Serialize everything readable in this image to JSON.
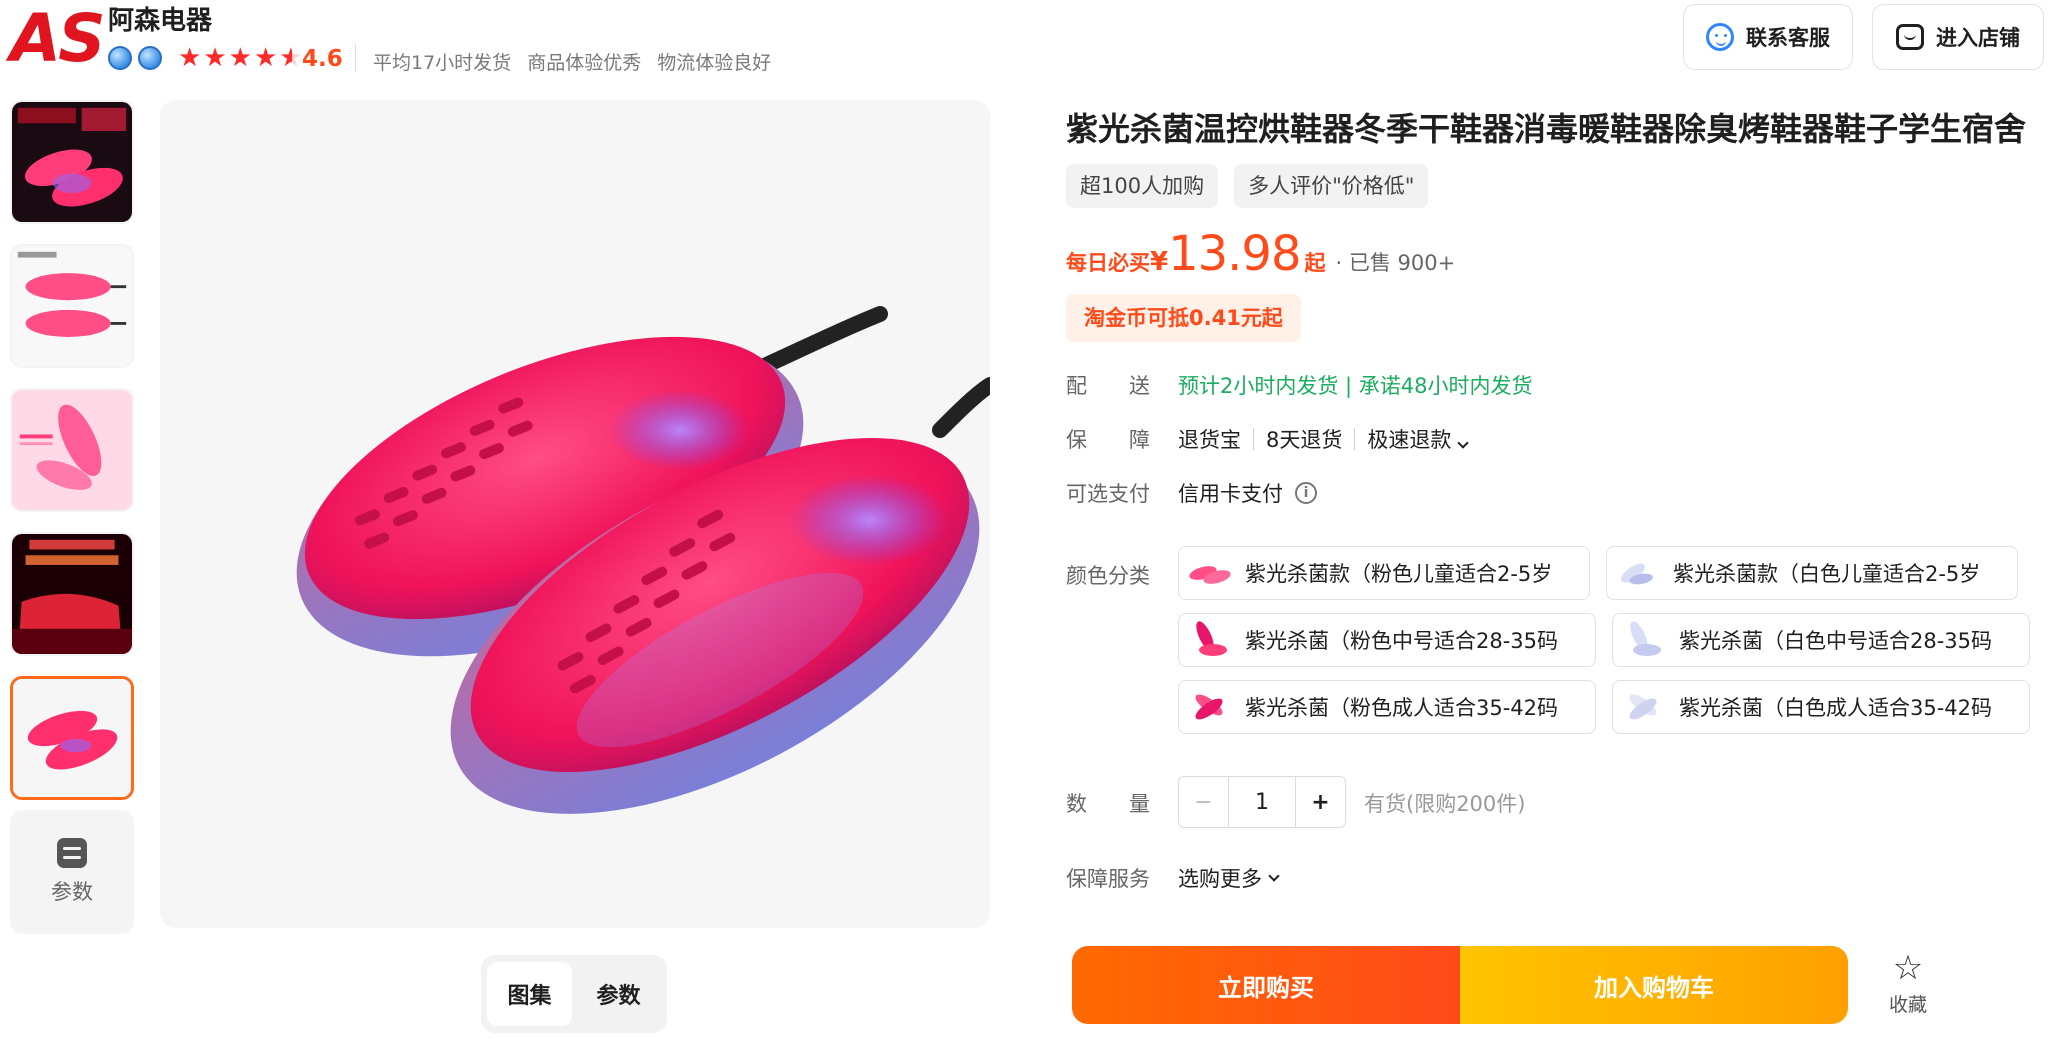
{
  "shop": {
    "logo_text": "AS",
    "name": "阿森电器",
    "rating": "4.6",
    "tags": [
      "平均17小时发货",
      "商品体验优秀",
      "物流体验良好"
    ],
    "contact_button": "联系客服",
    "store_button": "进入店铺"
  },
  "gallery": {
    "params_label": "参数",
    "tabs": [
      {
        "label": "图集",
        "selected": true
      },
      {
        "label": "参数",
        "selected": false
      }
    ]
  },
  "product": {
    "title": "紫光杀菌温控烘鞋器冬季干鞋器消毒暖鞋器除臭烤鞋器鞋子学生宿舍",
    "tags": [
      "超100人加购",
      "多人评价\"价格低\""
    ],
    "price": {
      "label": "每日必买",
      "currency": "¥",
      "amount": "13.98",
      "suffix": "起",
      "sold": "· 已售 900+"
    },
    "coin_offer": "淘金币可抵0.41元起",
    "delivery": {
      "label": "配送",
      "value": "预计2小时内发货 | 承诺48小时内发货"
    },
    "guarantee": {
      "label": "保障",
      "items": [
        "退货宝",
        "8天退货",
        "极速退款"
      ]
    },
    "payment": {
      "label": "可选支付",
      "value": "信用卡支付"
    },
    "color": {
      "label": "颜色分类",
      "options": [
        {
          "label": "紫光杀菌款（粉色儿童适合2-5岁",
          "tone": "pink"
        },
        {
          "label": "紫光杀菌款（白色儿童适合2-5岁",
          "tone": "white"
        },
        {
          "label": "紫光杀菌（粉色中号适合28-35码",
          "tone": "pink"
        },
        {
          "label": "紫光杀菌（白色中号适合28-35码",
          "tone": "white"
        },
        {
          "label": "紫光杀菌（粉色成人适合35-42码",
          "tone": "pink"
        },
        {
          "label": "紫光杀菌（白色成人适合35-42码",
          "tone": "white"
        }
      ]
    },
    "quantity": {
      "label": "数量",
      "minus": "−",
      "value": "1",
      "plus": "+",
      "stock": "有货(限购200件)"
    },
    "service": {
      "label": "保障服务",
      "value": "选购更多"
    }
  },
  "actions": {
    "buy": "立即购买",
    "cart": "加入购物车",
    "favorite": "收藏"
  },
  "colors": {
    "accent": "#ff4a1a",
    "green": "#1aad5f",
    "logo_red": "#e0151f",
    "buy_gradient": [
      "#ff6a00",
      "#ff4a1a"
    ],
    "cart_gradient": [
      "#ffc400",
      "#ffa000"
    ]
  }
}
